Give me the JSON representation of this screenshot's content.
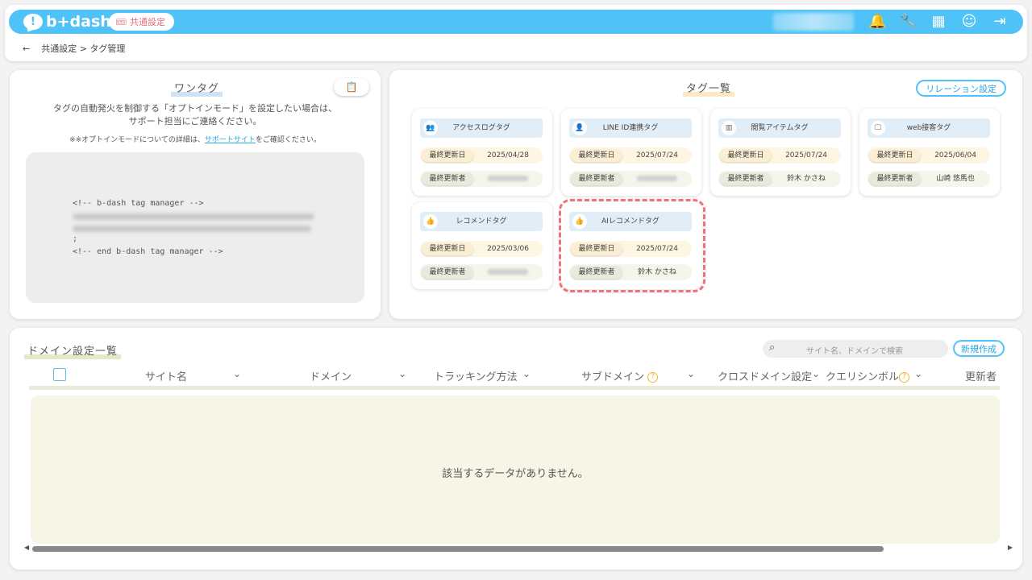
{
  "app": {
    "logo_text": "b+dash"
  },
  "header": {
    "common_settings_label": "共通設定",
    "icons": [
      "bell-icon",
      "wrench-icon",
      "grid-icon",
      "support-icon",
      "logout-icon"
    ]
  },
  "breadcrumb": {
    "back": "←",
    "path": "共通設定 > タグ管理"
  },
  "onetag": {
    "title": "ワンタグ",
    "desc_line1": "タグの自動発火を制御する「オプトインモード」を設定したい場合は、",
    "desc_line2": "サポート担当にご連絡ください。",
    "note_prefix": "※※オプトインモードについての詳細は、",
    "note_link": "サポートサイト",
    "note_suffix": "をご確認ください。",
    "code_start": "<!-- b-dash tag manager -->",
    "code_end": "<!-- end b-dash tag manager -->",
    "code_semicolon": ";"
  },
  "taglist": {
    "title": "タグ一覧",
    "relation_button": "リレーション設定",
    "date_label": "最終更新日",
    "user_label": "最終更新者",
    "tags": [
      {
        "name": "アクセスログタグ",
        "icon": "users-icon",
        "date": "2025/04/28",
        "user": ""
      },
      {
        "name": "LINE ID連携タグ",
        "icon": "person-icon",
        "date": "2025/07/24",
        "user": ""
      },
      {
        "name": "閲覧アイテムタグ",
        "icon": "item-icon",
        "date": "2025/07/24",
        "user": "鈴木 かさね"
      },
      {
        "name": "web接客タグ",
        "icon": "monitor-icon",
        "date": "2025/06/04",
        "user": "山崎 悠馬也"
      },
      {
        "name": "レコメンドタグ",
        "icon": "thumbs-up-icon",
        "date": "2025/03/06",
        "user": ""
      },
      {
        "name": "AIレコメンドタグ",
        "icon": "thumbs-up-icon",
        "date": "2025/07/24",
        "user": "鈴木 かさね"
      }
    ]
  },
  "domain": {
    "title": "ドメイン設定一覧",
    "search_placeholder": "サイト名、ドメインで検索",
    "new_button": "新規作成",
    "columns": {
      "site_name": "サイト名",
      "domain": "ドメイン",
      "tracking": "トラッキング方法",
      "subdomain": "サブドメイン",
      "crossdomain": "クロスドメイン設定",
      "querysymbol": "クエリシンボル",
      "updater": "更新者"
    },
    "qmark": "?",
    "empty_message": "該当するデータがありません。"
  },
  "colors": {
    "accent": "#4fc3f7",
    "highlight": "#f07178",
    "onetag_underline": "#cfe3f5",
    "taglist_underline": "#fbe9c3",
    "domain_underline": "#e4e9c8"
  }
}
